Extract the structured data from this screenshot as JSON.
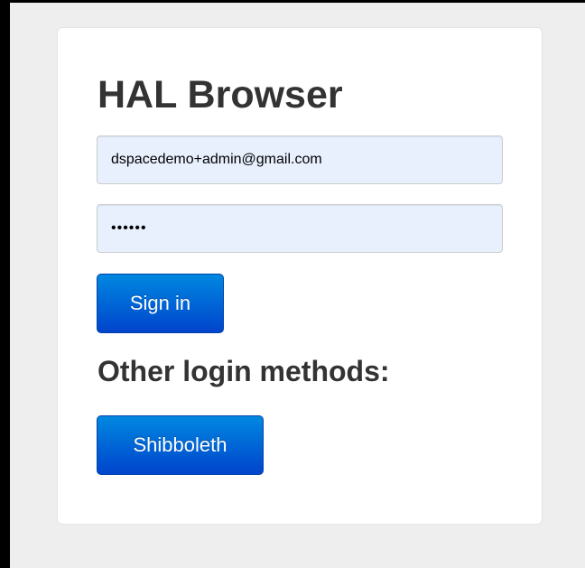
{
  "login": {
    "title": "HAL Browser",
    "email_value": "dspacedemo+admin@gmail.com",
    "password_value": "••••••",
    "sign_in_label": "Sign in",
    "other_methods_heading": "Other login methods:",
    "shibboleth_label": "Shibboleth"
  },
  "colors": {
    "button_top": "#0088e0",
    "button_bottom": "#0044cc",
    "field_background": "#e8f0fe",
    "page_background": "#eeeeee"
  }
}
